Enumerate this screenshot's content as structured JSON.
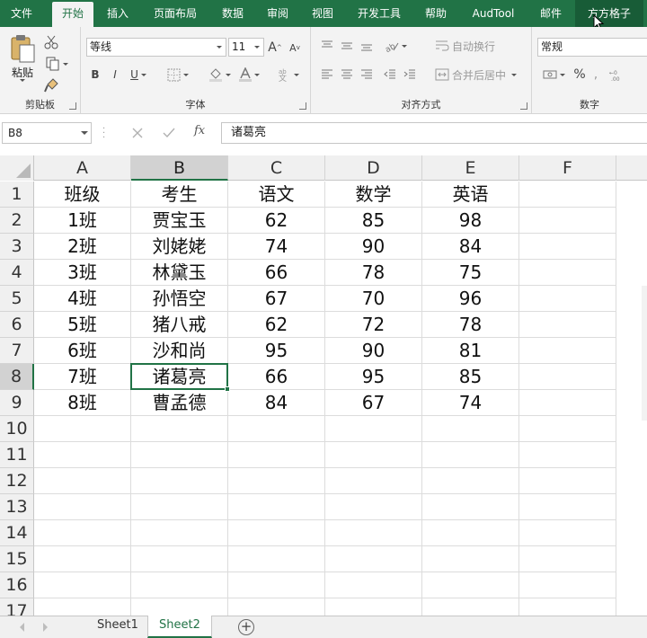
{
  "ribbon_tabs": [
    {
      "label": "文件"
    },
    {
      "label": "开始"
    },
    {
      "label": "插入"
    },
    {
      "label": "页面布局"
    },
    {
      "label": "数据"
    },
    {
      "label": "审阅"
    },
    {
      "label": "视图"
    },
    {
      "label": "开发工具"
    },
    {
      "label": "帮助"
    },
    {
      "label": "AudTool"
    },
    {
      "label": "邮件"
    },
    {
      "label": "方方格子"
    }
  ],
  "active_tab": "开始",
  "clipboard": {
    "group_label": "剪贴板",
    "paste_label": "粘贴"
  },
  "font": {
    "group_label": "字体",
    "name": "等线",
    "size": "11",
    "bold": "B",
    "italic": "I",
    "underline": "U",
    "grow": "A",
    "shrink": "A"
  },
  "alignment": {
    "group_label": "对齐方式",
    "wrap_label": "自动换行",
    "merge_label": "合并后居中"
  },
  "number": {
    "group_label": "数字",
    "format": "常规",
    "percent": "%"
  },
  "formula_bar": {
    "name_box": "B8",
    "fx": "fx",
    "value": "诸葛亮"
  },
  "grid": {
    "columns": [
      "A",
      "B",
      "C",
      "D",
      "E",
      "F"
    ],
    "rows": [
      "1",
      "2",
      "3",
      "4",
      "5",
      "6",
      "7",
      "8",
      "9",
      "10",
      "11",
      "12",
      "13",
      "14",
      "15",
      "16",
      "17"
    ],
    "selected_cell": "B8",
    "data": [
      [
        "班级",
        "考生",
        "语文",
        "数学",
        "英语"
      ],
      [
        "1班",
        "贾宝玉",
        "62",
        "85",
        "98"
      ],
      [
        "2班",
        "刘姥姥",
        "74",
        "90",
        "84"
      ],
      [
        "3班",
        "林黛玉",
        "66",
        "78",
        "75"
      ],
      [
        "4班",
        "孙悟空",
        "67",
        "70",
        "96"
      ],
      [
        "5班",
        "猪八戒",
        "62",
        "72",
        "78"
      ],
      [
        "6班",
        "沙和尚",
        "95",
        "90",
        "81"
      ],
      [
        "7班",
        "诸葛亮",
        "66",
        "95",
        "85"
      ],
      [
        "8班",
        "曹孟德",
        "84",
        "67",
        "74"
      ]
    ]
  },
  "sheets": [
    {
      "label": "Sheet1"
    },
    {
      "label": "Sheet2"
    }
  ],
  "active_sheet": "Sheet2",
  "colors": {
    "accent": "#217346",
    "header_bg": "#f0f0f0"
  }
}
